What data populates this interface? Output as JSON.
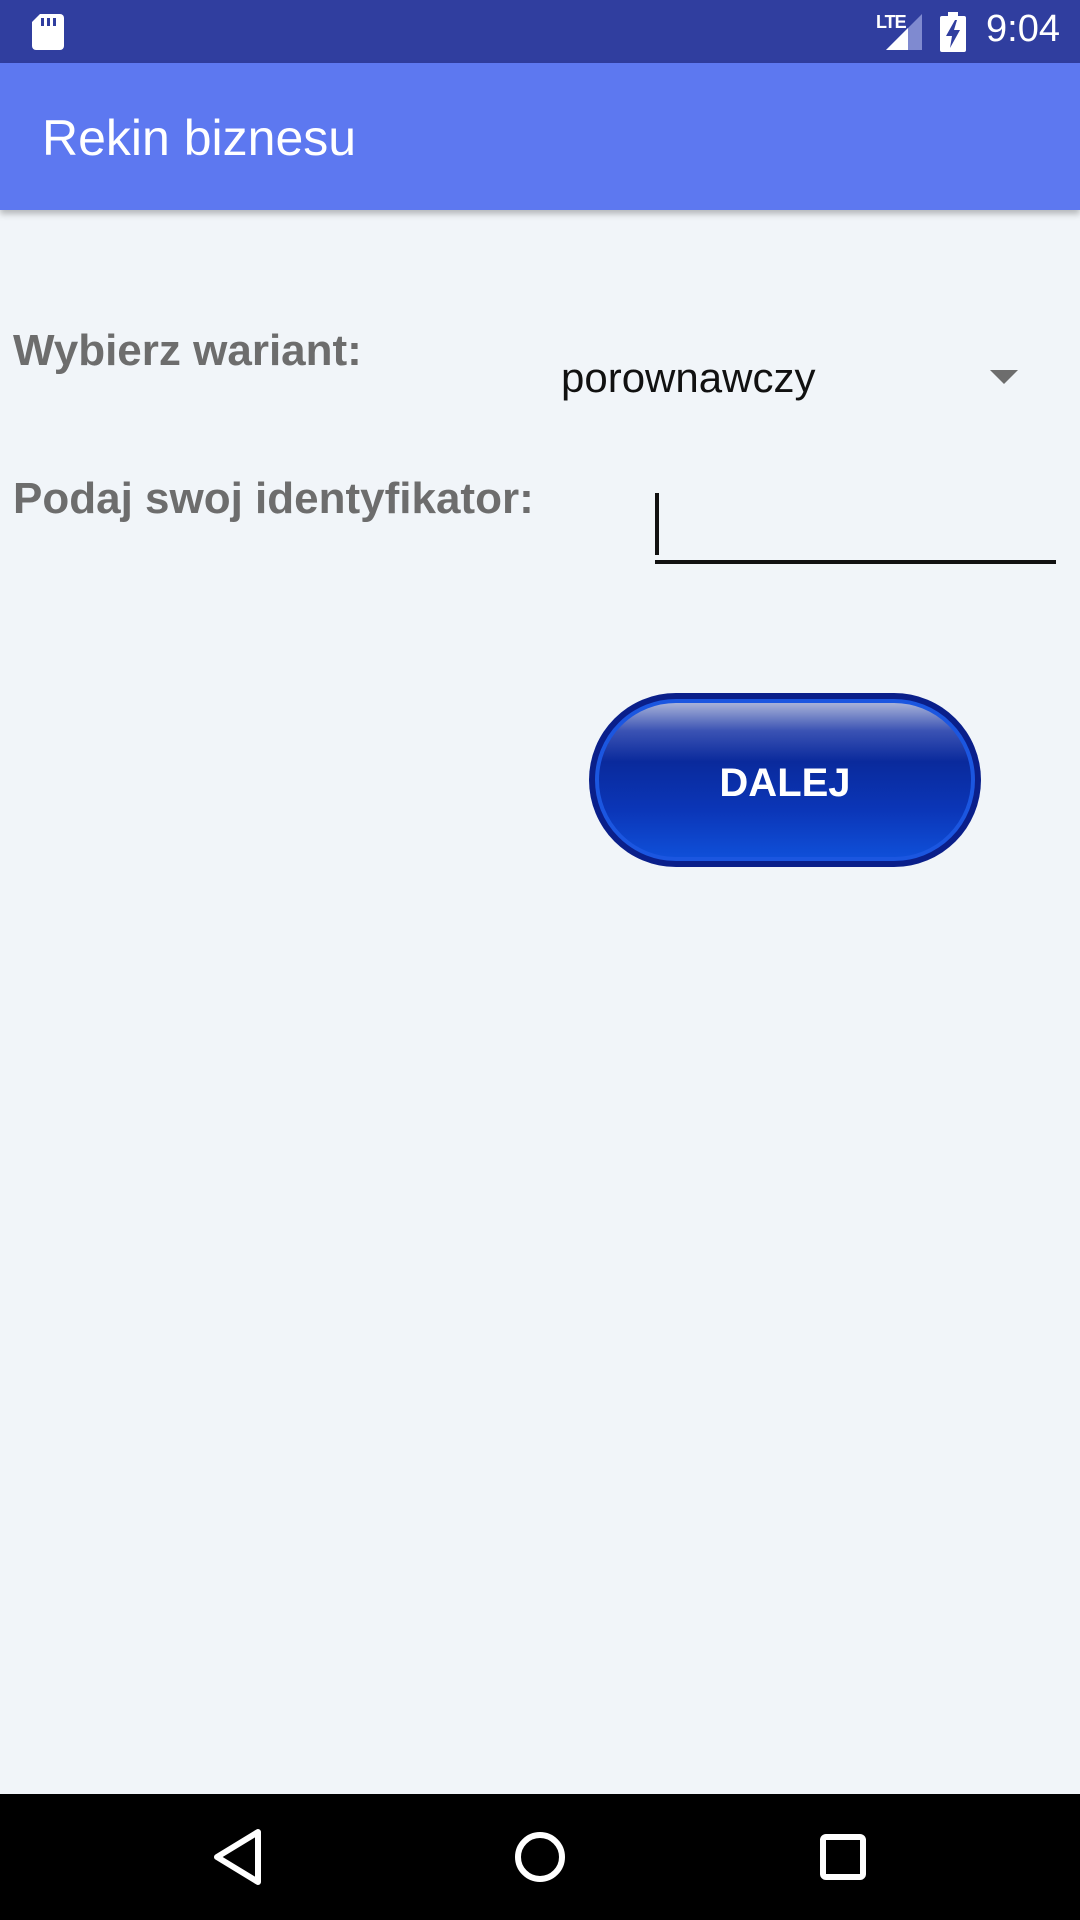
{
  "status_bar": {
    "time": "9:04",
    "network_label": "LTE",
    "icons": [
      "sd-card-icon",
      "signal-icon",
      "battery-charging-icon"
    ]
  },
  "app_bar": {
    "title": "Rekin biznesu",
    "color": "#5d78f0"
  },
  "form": {
    "variant_label": "Wybierz wariant:",
    "variant_selected": "porownawczy",
    "id_label": "Podaj swoj identyfikator:",
    "id_value": ""
  },
  "actions": {
    "next_label": "DALEJ"
  },
  "nav_bar": {
    "icons": [
      "back-icon",
      "home-icon",
      "recents-icon"
    ]
  },
  "colors": {
    "status_bar": "#303e9f",
    "background": "#f1f5f9",
    "label_text": "#6d6d6d",
    "button": "#0a2a9c"
  }
}
